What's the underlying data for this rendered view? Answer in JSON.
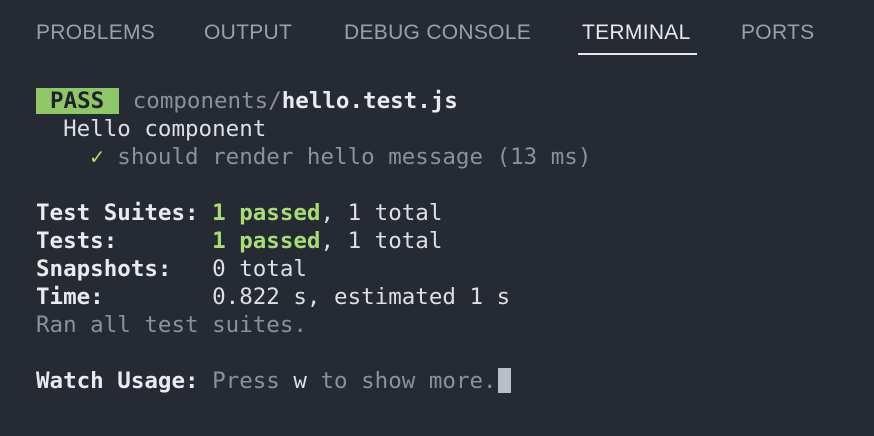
{
  "tabs": {
    "problems": "PROBLEMS",
    "output": "OUTPUT",
    "debug_console": "DEBUG CONSOLE",
    "terminal": "TERMINAL",
    "ports": "PORTS",
    "active": "terminal"
  },
  "terminal": {
    "pass_badge": "PASS",
    "test_path_dir": "components/",
    "test_path_file": "hello.test.js",
    "describe_name": "Hello component",
    "check_mark": "✓",
    "test_name": "should render hello message (13 ms)",
    "summary": {
      "suites_label": "Test Suites:",
      "suites_passed": "1 passed",
      "suites_rest": ", 1 total",
      "tests_label": "Tests:",
      "tests_passed": "1 passed",
      "tests_rest": ", 1 total",
      "snapshots_label": "Snapshots:",
      "snapshots_value": "0 total",
      "time_label": "Time:",
      "time_value": "0.822 s, estimated 1 s",
      "ran_all": "Ran all test suites."
    },
    "watch": {
      "label": "Watch Usage:",
      "press": " Press ",
      "key": "w",
      "rest": " to show more."
    }
  },
  "colors": {
    "background": "#252a33",
    "pass_badge_bg": "#8fc768",
    "success_green": "#a9dc76",
    "active_tab": "#e6e8ec",
    "inactive_tab": "#9aa0ab"
  }
}
